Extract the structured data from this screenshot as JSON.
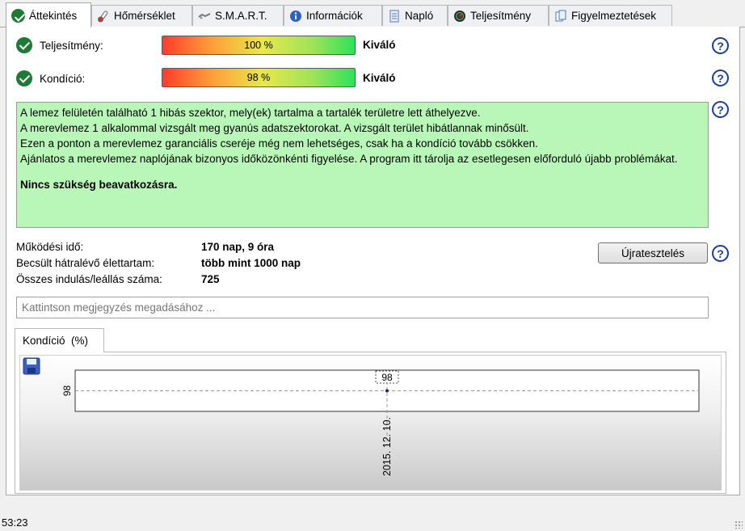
{
  "tabs": [
    {
      "label": "Áttekintés",
      "icon": "check-icon"
    },
    {
      "label": "Hőmérséklet",
      "icon": "thermometer-icon"
    },
    {
      "label": "S.M.A.R.T.",
      "icon": "smart-icon"
    },
    {
      "label": "Információk",
      "icon": "info-icon"
    },
    {
      "label": "Napló",
      "icon": "log-icon"
    },
    {
      "label": "Teljesítmény",
      "icon": "performance-icon"
    },
    {
      "label": "Figyelmeztetések",
      "icon": "warnings-icon"
    }
  ],
  "health": {
    "performance": {
      "label": "Teljesítmény:",
      "percent_text": "100 %",
      "percent": 100,
      "rating": "Kiváló"
    },
    "condition": {
      "label": "Kondíció:",
      "percent_text": "98 %",
      "percent": 98,
      "rating": "Kiváló"
    }
  },
  "message": {
    "lines": [
      "A lemez felületén található 1 hibás szektor, mely(ek) tartalma a tartalék területre lett áthelyezve.",
      "A merevlemez 1 alkalommal vizsgált meg gyanús adatszektorokat. A vizsgált terület hibátlannak minősült.",
      "Ezen a ponton a merevlemez garanciális cseréje még nem lehetséges, csak ha a kondíció tovább csökken.",
      "Ajánlatos a merevlemez naplójának bizonyos időközönkénti figyelése. A program itt tárolja az esetlegesen előforduló újabb problémákat."
    ],
    "conclusion": "Nincs szükség beavatkozásra."
  },
  "stats": {
    "uptime": {
      "label": "Működési idő:",
      "value": "170 nap, 9 óra"
    },
    "remaining": {
      "label": "Becsült hátralévő élettartam:",
      "value": "több mint 1000 nap"
    },
    "starts": {
      "label": "Összes indulás/leállás száma:",
      "value": "725"
    }
  },
  "retest_button": "Újratesztelés",
  "help_glyph": "?",
  "note_placeholder": "Kattintson megjegyzés megadásához ...",
  "subtab_label": "Kondíció  (%)",
  "status_time": "53:23",
  "colors": {
    "message_bg": "#b9f7b9",
    "check_green": "#1f7a36",
    "help_blue": "#1a3f9a"
  },
  "chart_data": {
    "type": "line",
    "x": [
      "2015. 12. 10."
    ],
    "series": [
      {
        "values": [
          98
        ]
      }
    ],
    "data_labels": [
      "98"
    ],
    "y_tick_labels": [
      "98"
    ],
    "x_tick_labels": [
      "2015. 12. 10."
    ],
    "grid": true
  }
}
